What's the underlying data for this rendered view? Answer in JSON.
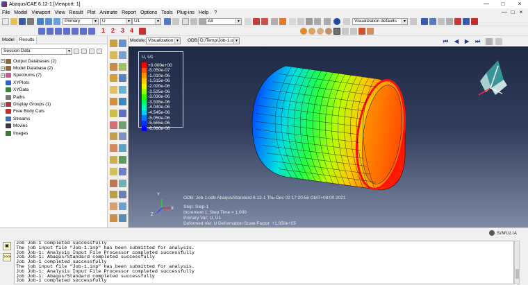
{
  "window": {
    "title": "Abaqus/CAE 6.12-1 [Viewport: 1]",
    "controls": [
      "—",
      "□",
      "×"
    ]
  },
  "menubar": {
    "items": [
      "File",
      "Model",
      "Viewport",
      "View",
      "Result",
      "Plot",
      "Animate",
      "Report",
      "Options",
      "Tools",
      "Plug-ins",
      "Help"
    ],
    "help_icon": "?",
    "right_controls": [
      "—",
      "□",
      "×"
    ]
  },
  "toolbar": {
    "step_select": "Primary",
    "variable_select": "U",
    "component_select": "U1",
    "numbers": [
      "1",
      "2",
      "3",
      "4"
    ],
    "filter_select": "All",
    "render_style_select": "Visualization defaults"
  },
  "leftpanel": {
    "tabs": [
      "Model",
      "Results"
    ],
    "session_select": "Session Data",
    "tree": [
      {
        "label": "Output Databases (2)",
        "expandable": true,
        "icon_color": "#8a6b3a"
      },
      {
        "label": "Model Database (2)",
        "expandable": true,
        "icon_color": "#8a6b3a"
      },
      {
        "label": "Spectrums (7)",
        "expandable": true,
        "icon_color": "#c85a9a"
      },
      {
        "label": "XYPlots",
        "expandable": false,
        "icon_color": "#3060c0"
      },
      {
        "label": "XYData",
        "expandable": false,
        "icon_color": "#3a8040"
      },
      {
        "label": "Paths",
        "expandable": false,
        "icon_color": "#7a7a7a"
      },
      {
        "label": "Display Groups (1)",
        "expandable": true,
        "icon_color": "#a04040"
      },
      {
        "label": "Free Body Cuts",
        "expandable": false,
        "icon_color": "#c03030"
      },
      {
        "label": "Streams",
        "expandable": false,
        "icon_color": "#4a6ab0"
      },
      {
        "label": "Movies",
        "expandable": false,
        "icon_color": "#3a3a3a"
      },
      {
        "label": "Images",
        "expandable": false,
        "icon_color": "#3a7a3a"
      }
    ]
  },
  "modulebar": {
    "module_label": "Module:",
    "module_value": "Visualization",
    "odb_label": "ODB:",
    "odb_value": "D:/Temp/Job-1.odb"
  },
  "legend": {
    "title": "U, U1",
    "entries": [
      {
        "value": "+0.000e+00",
        "color": "#ff0000"
      },
      {
        "value": "-5.050e-07",
        "color": "#ff5a00"
      },
      {
        "value": "-1.010e-06",
        "color": "#ff9900"
      },
      {
        "value": "-1.515e-06",
        "color": "#ffcc00"
      },
      {
        "value": "-2.020e-06",
        "color": "#e6ff00"
      },
      {
        "value": "-2.525e-06",
        "color": "#9cff00"
      },
      {
        "value": "-3.030e-06",
        "color": "#33ff00"
      },
      {
        "value": "-3.535e-06",
        "color": "#00ff66"
      },
      {
        "value": "-4.040e-06",
        "color": "#00ffcc"
      },
      {
        "value": "-4.545e-06",
        "color": "#00ccff"
      },
      {
        "value": "-5.050e-06",
        "color": "#0077ff"
      },
      {
        "value": "-5.555e-06",
        "color": "#0033ff"
      },
      {
        "value": "-6.060e-06",
        "color": "#0000ee"
      }
    ]
  },
  "viewport_info": {
    "line1": "ODB: Job-1.odb    Abaqus/Standard 6.12-1    Thu Dec 02 17:20:56 GMT+08:00 2021",
    "line2": "Step: Step-1",
    "line3": "Increment     1: Step Time =     1.000",
    "line4": "Primary Var: U, U1",
    "line5": "Deformed Var: U   Deformation Scale Factor: +1.650e+05",
    "brand": "SIMULIA",
    "triad_labels": [
      "X",
      "Y",
      "Z"
    ]
  },
  "messages": [
    "Job Job-1 completed successfully",
    "The job input file \"Job-1.inp\" has been submitted for analysis.",
    "Job Job-1: Analysis Input File Processor completed successfully",
    "Job Job-1: Abaqus/Standard completed successfully",
    "Job Job-1 completed successfully",
    "The job input file \"Job-1.inp\" has been submitted for analysis.",
    "Job Job-1: Analysis Input File Processor completed successfully",
    "Job Job-1: Abaqus/Standard completed successfully",
    "Job Job-1 completed successfully"
  ],
  "message_buttons": [
    "▣",
    ">>>"
  ]
}
